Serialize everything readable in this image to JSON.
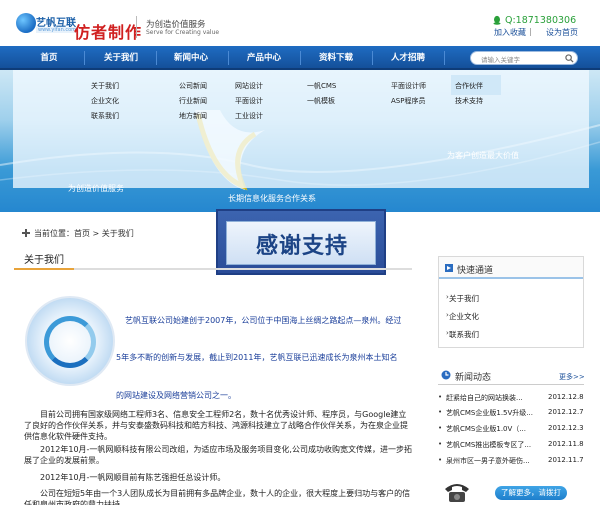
{
  "header": {
    "logo_cn": "艺帆互联",
    "logo_en": "www.yifan.com",
    "title": "仿者制作",
    "slogan_cn": "为创造价值服务",
    "slogan_en": "Serve for Creating value",
    "phone": "Q:1871380306",
    "favorite_label": "加入收藏",
    "separator": "|",
    "homepage_label": "设为首页"
  },
  "nav": {
    "items": [
      "首页",
      "关于我们",
      "新闻中心",
      "产品中心",
      "资料下载",
      "人才招聘"
    ],
    "search_placeholder": "请输入关键字"
  },
  "dropdown": {
    "about": [
      "关于我们",
      "企业文化",
      "联系我们"
    ],
    "news": [
      "公司新闻",
      "行业新闻",
      "地方新闻"
    ],
    "design": [
      "网站设计",
      "平面设计",
      "工业设计"
    ],
    "cms": [
      "一帆CMS",
      "一帆模板"
    ],
    "design2": [
      "平面设计师",
      "ASP程序员"
    ],
    "hr": [
      "合作伙伴",
      "技术支持"
    ]
  },
  "banner": {
    "left_text": "为创造价值服务",
    "center_text": "长期信息化服务合作关系",
    "right_text": "为客户创造最大价值",
    "badge": "感谢支持"
  },
  "breadcrumb": {
    "label": "当前位置：首页 > 关于我们"
  },
  "main": {
    "title": "关于我们",
    "intro_line1": "艺帆互联公司始建创于2007年，公司位于中国海上丝绸之路起点—泉州。经过",
    "intro_line2": "5年多不断的创新与发展，截止到2011年，艺帆互联已迅速成长为泉州本土知名",
    "intro_line3": "的网站建设及网络营销公司之一。",
    "para1": "目前公司拥有国家级网络工程师3名、信息安全工程师2名，数十名优秀设计师、程序员，与Google建立了良好的合作伙伴关系，并与安泰盛数码科技和皓方科技、鸿源科技建立了战略合作伙伴关系，为在泉企业提供信息化软件硬件支持。",
    "para2": "2012年10月-一帆网顺科技有限公司改组，为适应市场及服务项目变化,公司成功收购宽文传媒，进一步拓展了企业的发展前景。",
    "para3": "2012年10月-一帆网顺目前有陈艺强担任总设计师。",
    "para4": "公司在短短5年由一个3人团队成长为目前拥有多品牌企业，数十人的企业，很大程度上要归功与客户的信任和泉州市政府的鼎力扶持。"
  },
  "sidebar": {
    "quick_title": "快速通道",
    "quick_links": [
      "关于我们",
      "企业文化",
      "联系我们"
    ],
    "news_title": "新闻动态",
    "more_label": "更多>>",
    "news": [
      {
        "title": "赶紧给自己的网站换装...",
        "date": "2012.12.8"
      },
      {
        "title": "艺帆CMS企业版1.5V升级...",
        "date": "2012.12.7"
      },
      {
        "title": "艺帆CMS企业版1.0V（...",
        "date": "2012.12.3"
      },
      {
        "title": "艺帆CMS推出模板专区了...",
        "date": "2012.11.8"
      },
      {
        "title": "泉州市区一男子意外砸伤...",
        "date": "2012.11.7"
      }
    ],
    "contact_label": "了解更多，请拨打"
  }
}
